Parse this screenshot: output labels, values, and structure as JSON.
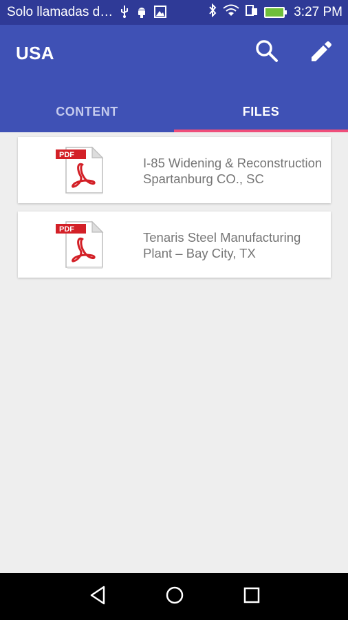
{
  "status_bar": {
    "carrier": "Solo llamadas d…",
    "time": "3:27 PM",
    "notification_icons": [
      "usb-icon",
      "android-debug-icon",
      "image-icon"
    ],
    "system_icons": [
      "bluetooth-icon",
      "wifi-icon",
      "sim-icon",
      "battery-charging-icon"
    ]
  },
  "app_bar": {
    "title": "USA",
    "actions": [
      "search-icon",
      "edit-icon"
    ]
  },
  "tabs": [
    {
      "label": "CONTENT",
      "active": false
    },
    {
      "label": "FILES",
      "active": true
    }
  ],
  "files": [
    {
      "icon": "pdf-icon",
      "name": "I-85 Widening & Reconstruction\nSpartanburg CO., SC"
    },
    {
      "icon": "pdf-icon",
      "name": "Tenaris Steel Manufacturing\nPlant – Bay City, TX"
    }
  ],
  "pdf_badge": "PDF",
  "colors": {
    "status_bar": "#2f3a97",
    "app_bar": "#3f51b5",
    "tab_indicator": "#ef4e7a",
    "background": "#eeeeee",
    "pdf_red": "#d32027"
  },
  "nav_bar": [
    "back-icon",
    "home-icon",
    "recents-icon"
  ]
}
